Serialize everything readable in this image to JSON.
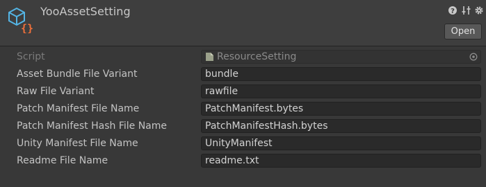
{
  "header": {
    "title": "YooAssetSetting",
    "open_button": "Open"
  },
  "fields": [
    {
      "label": "Script",
      "value": "ResourceSetting",
      "disabled": true
    },
    {
      "label": "Asset Bundle File Variant",
      "value": "bundle"
    },
    {
      "label": "Raw File Variant",
      "value": "rawfile"
    },
    {
      "label": "Patch Manifest File Name",
      "value": "PatchManifest.bytes"
    },
    {
      "label": "Patch Manifest Hash File Name",
      "value": "PatchManifestHash.bytes"
    },
    {
      "label": "Unity Manifest File Name",
      "value": "UnityManifest"
    },
    {
      "label": "Readme File Name",
      "value": "readme.txt"
    }
  ],
  "colors": {
    "background": "#383838",
    "field_background": "#2a2a2a",
    "icon_blue": "#54b4e4",
    "icon_orange": "#f0703a"
  },
  "icons": [
    "scriptable-object-icon",
    "help-icon",
    "preset-icon",
    "settings-icon",
    "script-file-icon",
    "object-picker-icon"
  ]
}
